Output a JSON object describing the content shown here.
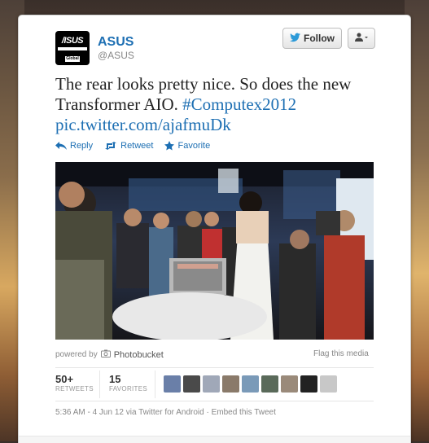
{
  "user": {
    "name": "ASUS",
    "handle": "@ASUS",
    "avatar_logo": "/ISUS",
    "avatar_badge": "Global"
  },
  "buttons": {
    "follow_label": "Follow",
    "follow_icon": "bird-icon",
    "user_menu_icon": "person-icon"
  },
  "tweet": {
    "text": "The rear looks pretty nice. So does the new Transformer AIO.",
    "hashtag": "#Computex2012",
    "link": "pic.twitter.com/ajafmuDk"
  },
  "actions": [
    {
      "label": "Reply",
      "icon": "reply-icon"
    },
    {
      "label": "Retweet",
      "icon": "retweet-icon"
    },
    {
      "label": "Favorite",
      "icon": "star-icon"
    }
  ],
  "media": {
    "powered_by": "powered by",
    "provider": "Photobucket",
    "flag_label": "Flag this media"
  },
  "stats": {
    "retweets": {
      "count": "50+",
      "label": "RETWEETS"
    },
    "favorites": {
      "count": "15",
      "label": "FAVORITES"
    }
  },
  "favoriters": [
    {
      "color": "#6a7fa8"
    },
    {
      "color": "#4a4a4a"
    },
    {
      "color": "#a0a8b8"
    },
    {
      "color": "#8a7a6a"
    },
    {
      "color": "#7a9ab8"
    },
    {
      "color": "#5a6a5a"
    },
    {
      "color": "#9a8a7a"
    },
    {
      "color": "#222222"
    },
    {
      "color": "#c8c8c8"
    }
  ],
  "meta": {
    "text": "5:36 AM - 4 Jun 12 via Twitter for Android · Embed this Tweet"
  },
  "colors": {
    "link": "#1d6fb3",
    "text": "#222222",
    "muted": "#888888"
  }
}
